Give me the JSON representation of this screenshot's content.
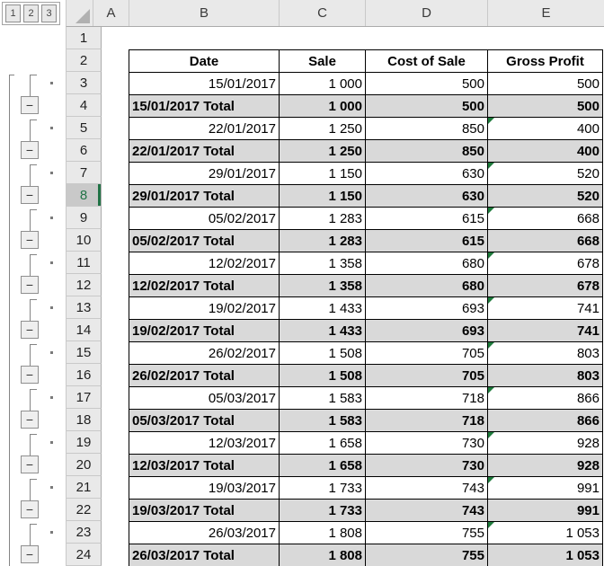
{
  "outline": {
    "level_buttons": [
      "1",
      "2",
      "3"
    ],
    "collapse_glyph": "−"
  },
  "sheet": {
    "column_headers": [
      "A",
      "B",
      "C",
      "D",
      "E"
    ],
    "row_headers": [
      "1",
      "2",
      "3",
      "4",
      "5",
      "6",
      "7",
      "8",
      "9",
      "10",
      "11",
      "12",
      "13",
      "14",
      "15",
      "16",
      "17",
      "18",
      "19",
      "20",
      "21",
      "22",
      "23",
      "24"
    ],
    "selected_row": "8"
  },
  "table": {
    "headers": [
      "Date",
      "Sale",
      "Cost of Sale",
      "Gross Profit"
    ],
    "rows": [
      {
        "row": "3",
        "type": "detail",
        "date": "15/01/2017",
        "sale": "1 000",
        "cost_of_sale": "500",
        "gross_profit": "500",
        "error_indicator": false
      },
      {
        "row": "4",
        "type": "total",
        "date": "15/01/2017 Total",
        "sale": "1 000",
        "cost_of_sale": "500",
        "gross_profit": "500",
        "error_indicator": false
      },
      {
        "row": "5",
        "type": "detail",
        "date": "22/01/2017",
        "sale": "1 250",
        "cost_of_sale": "850",
        "gross_profit": "400",
        "error_indicator": true
      },
      {
        "row": "6",
        "type": "total",
        "date": "22/01/2017 Total",
        "sale": "1 250",
        "cost_of_sale": "850",
        "gross_profit": "400",
        "error_indicator": false
      },
      {
        "row": "7",
        "type": "detail",
        "date": "29/01/2017",
        "sale": "1 150",
        "cost_of_sale": "630",
        "gross_profit": "520",
        "error_indicator": true
      },
      {
        "row": "8",
        "type": "total",
        "date": "29/01/2017 Total",
        "sale": "1 150",
        "cost_of_sale": "630",
        "gross_profit": "520",
        "error_indicator": false
      },
      {
        "row": "9",
        "type": "detail",
        "date": "05/02/2017",
        "sale": "1 283",
        "cost_of_sale": "615",
        "gross_profit": "668",
        "error_indicator": true
      },
      {
        "row": "10",
        "type": "total",
        "date": "05/02/2017 Total",
        "sale": "1 283",
        "cost_of_sale": "615",
        "gross_profit": "668",
        "error_indicator": false
      },
      {
        "row": "11",
        "type": "detail",
        "date": "12/02/2017",
        "sale": "1 358",
        "cost_of_sale": "680",
        "gross_profit": "678",
        "error_indicator": true
      },
      {
        "row": "12",
        "type": "total",
        "date": "12/02/2017 Total",
        "sale": "1 358",
        "cost_of_sale": "680",
        "gross_profit": "678",
        "error_indicator": false
      },
      {
        "row": "13",
        "type": "detail",
        "date": "19/02/2017",
        "sale": "1 433",
        "cost_of_sale": "693",
        "gross_profit": "741",
        "error_indicator": true
      },
      {
        "row": "14",
        "type": "total",
        "date": "19/02/2017 Total",
        "sale": "1 433",
        "cost_of_sale": "693",
        "gross_profit": "741",
        "error_indicator": false
      },
      {
        "row": "15",
        "type": "detail",
        "date": "26/02/2017",
        "sale": "1 508",
        "cost_of_sale": "705",
        "gross_profit": "803",
        "error_indicator": true
      },
      {
        "row": "16",
        "type": "total",
        "date": "26/02/2017 Total",
        "sale": "1 508",
        "cost_of_sale": "705",
        "gross_profit": "803",
        "error_indicator": false
      },
      {
        "row": "17",
        "type": "detail",
        "date": "05/03/2017",
        "sale": "1 583",
        "cost_of_sale": "718",
        "gross_profit": "866",
        "error_indicator": true
      },
      {
        "row": "18",
        "type": "total",
        "date": "05/03/2017 Total",
        "sale": "1 583",
        "cost_of_sale": "718",
        "gross_profit": "866",
        "error_indicator": false
      },
      {
        "row": "19",
        "type": "detail",
        "date": "12/03/2017",
        "sale": "1 658",
        "cost_of_sale": "730",
        "gross_profit": "928",
        "error_indicator": true
      },
      {
        "row": "20",
        "type": "total",
        "date": "12/03/2017 Total",
        "sale": "1 658",
        "cost_of_sale": "730",
        "gross_profit": "928",
        "error_indicator": false
      },
      {
        "row": "21",
        "type": "detail",
        "date": "19/03/2017",
        "sale": "1 733",
        "cost_of_sale": "743",
        "gross_profit": "991",
        "error_indicator": true
      },
      {
        "row": "22",
        "type": "total",
        "date": "19/03/2017 Total",
        "sale": "1 733",
        "cost_of_sale": "743",
        "gross_profit": "991",
        "error_indicator": false
      },
      {
        "row": "23",
        "type": "detail",
        "date": "26/03/2017",
        "sale": "1 808",
        "cost_of_sale": "755",
        "gross_profit": "1 053",
        "error_indicator": true
      },
      {
        "row": "24",
        "type": "total",
        "date": "26/03/2017 Total",
        "sale": "1 808",
        "cost_of_sale": "755",
        "gross_profit": "1 053",
        "error_indicator": false
      }
    ]
  },
  "colors": {
    "selection_green": "#217346",
    "error_indicator_green": "#1E7B3C",
    "total_row_bg": "#D9D9D9",
    "header_bg": "#E9E9E9"
  }
}
